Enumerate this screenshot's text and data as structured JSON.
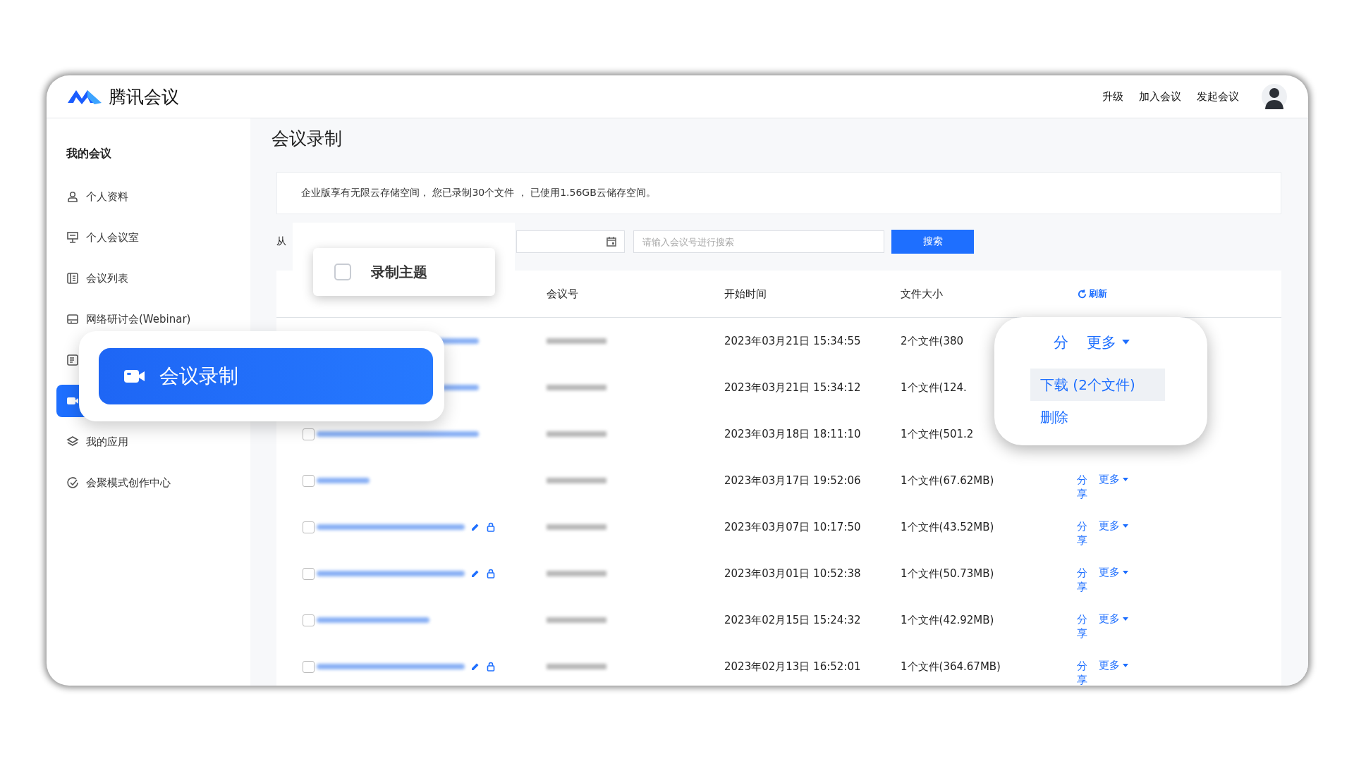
{
  "header": {
    "app_name": "腾讯会议",
    "links": [
      "升级",
      "加入会议",
      "发起会议"
    ]
  },
  "sidebar": {
    "title": "我的会议",
    "items": [
      {
        "label": "个人资料",
        "selected": false
      },
      {
        "label": "个人会议室",
        "selected": false
      },
      {
        "label": "会议列表",
        "selected": false
      },
      {
        "label": "网络研讨会(Webinar)",
        "selected": false
      },
      {
        "selected": false
      },
      {
        "selected": true
      },
      {
        "label": "我的应用",
        "selected": false
      },
      {
        "label": "会聚模式创作中心",
        "selected": false
      }
    ]
  },
  "page_title": "会议录制",
  "notice": "企业版享有无限云存储空间， 您已录制30个文件 ， 已使用1.56GB云储存空间。",
  "filter": {
    "from_label": "从",
    "search_placeholder": "请输入会议号进行搜索",
    "search_button": "搜索"
  },
  "table": {
    "columns": [
      "会议号",
      "开始时间",
      "文件大小"
    ],
    "refresh": "刷新",
    "rows": [
      {
        "start": "2023年03月21日 15:34:55",
        "size": "2个文件(380",
        "locked": false
      },
      {
        "start": "2023年03月21日 15:34:12",
        "size": "1个文件(124.",
        "locked": false
      },
      {
        "checked": false,
        "start": "2023年03月18日 18:11:10",
        "size": "1个文件(501.2",
        "locked": false
      },
      {
        "checked": false,
        "start": "2023年03月17日 19:52:06",
        "size": "1个文件(67.62MB)",
        "locked": false,
        "share": "分享",
        "more": "更多"
      },
      {
        "checked": false,
        "start": "2023年03月07日 10:17:50",
        "size": "1个文件(43.52MB)",
        "locked": true,
        "share": "分享",
        "more": "更多"
      },
      {
        "checked": false,
        "start": "2023年03月01日 10:52:38",
        "size": "1个文件(50.73MB)",
        "locked": true,
        "share": "分享",
        "more": "更多"
      },
      {
        "checked": false,
        "start": "2023年02月15日 15:24:32",
        "size": "1个文件(42.92MB)",
        "locked": false,
        "share": "分享",
        "more": "更多"
      },
      {
        "checked": false,
        "start": "2023年02月13日 16:52:01",
        "size": "1个文件(364.67MB)",
        "locked": true,
        "share": "分享",
        "more": "更多"
      }
    ]
  },
  "callouts": {
    "topic": {
      "label": "录制主题",
      "checked": false
    },
    "nav": {
      "label": "会议录制"
    },
    "menu": {
      "share": "分",
      "more": "更多",
      "items": [
        {
          "label": "下载 (2个文件)",
          "selected": true
        },
        {
          "label": "删除",
          "selected": false
        }
      ]
    }
  }
}
